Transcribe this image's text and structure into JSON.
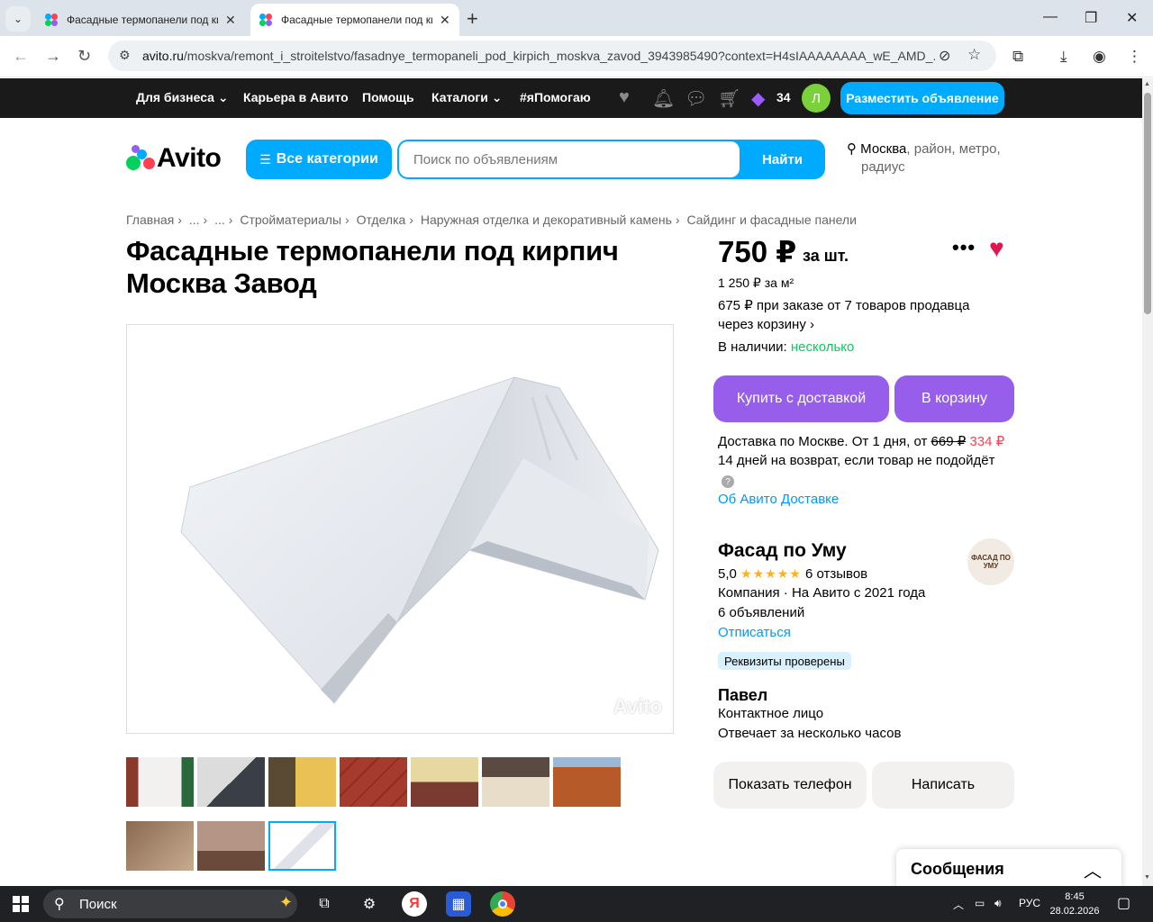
{
  "browser": {
    "tabs": [
      {
        "title": "Фасадные термопанели под кирпич",
        "active": false
      },
      {
        "title": "Фасадные термопанели под кирпич",
        "active": true
      }
    ],
    "url_host": "avito.ru",
    "url_path": "/moskva/remont_i_stroitelstvo/fasadnye_termopaneli_pod_kirpich_moskva_zavod_3943985490?context=H4sIAAAAAAAA_wE_AMD_..."
  },
  "topnav": {
    "items": [
      "Для бизнеса",
      "Карьера в Авито",
      "Помощь",
      "Каталоги",
      "#яПомогаю"
    ],
    "wallet_count": "34",
    "avatar_letter": "Л",
    "post_button": "Разместить объявление"
  },
  "header": {
    "logo_text": "Avito",
    "categories_button": "Все категории",
    "search_placeholder": "Поиск по объявлениям",
    "search_button": "Найти",
    "location_city": "Москва",
    "location_rest_1": ", район, метро,",
    "location_rest_2": "радиус"
  },
  "breadcrumbs": [
    "Главная",
    "...",
    "...",
    "Стройматериалы",
    "Отделка",
    "Наружная отделка и декоративный камень",
    "Сайдинг и фасадные панели"
  ],
  "listing": {
    "title_line1": "Фасадные термопанели под кирпич",
    "title_line2": "Москва Завод",
    "watermark": "Avito"
  },
  "price": {
    "amount": "750 ₽",
    "per": "за шт.",
    "per_m2": "1 250 ₽ за м²",
    "bulk_line1": "675 ₽ при заказе от 7 товаров продавца",
    "bulk_line2": "через корзину",
    "availability_label": "В наличии:",
    "availability_value": "несколько"
  },
  "buttons": {
    "buy_delivery": "Купить с доставкой",
    "to_cart": "В корзину",
    "show_phone": "Показать телефон",
    "write": "Написать"
  },
  "delivery": {
    "text": "Доставка по Москве. От 1 дня, от",
    "old_price": "669 ₽",
    "new_price": "334 ₽",
    "returns": "14 дней на возврат, если товар не подойдёт",
    "about_link": "Об Авито Доставке"
  },
  "seller": {
    "name": "Фасад по Уму",
    "rating": "5,0",
    "stars": "★★★★★",
    "reviews": "6 отзывов",
    "type": "Компания · На Авито с 2021 года",
    "listings": "6 объявлений",
    "unsubscribe": "Отписаться",
    "badge": "Реквизиты проверены",
    "logo_text": "ФАСАД ПО УМУ"
  },
  "contact": {
    "name": "Павел",
    "role": "Контактное лицо",
    "response": "Отвечает за несколько часов"
  },
  "messages": {
    "label": "Сообщения"
  },
  "taskbar": {
    "search_label": "Поиск",
    "lang": "РУС",
    "time": "8:45",
    "date": "28.02.2026"
  },
  "colors": {
    "accent_blue": "#00aaff",
    "purple": "#965eeb",
    "green": "#02d15c",
    "red": "#ff4053",
    "heart": "#e0174f"
  }
}
